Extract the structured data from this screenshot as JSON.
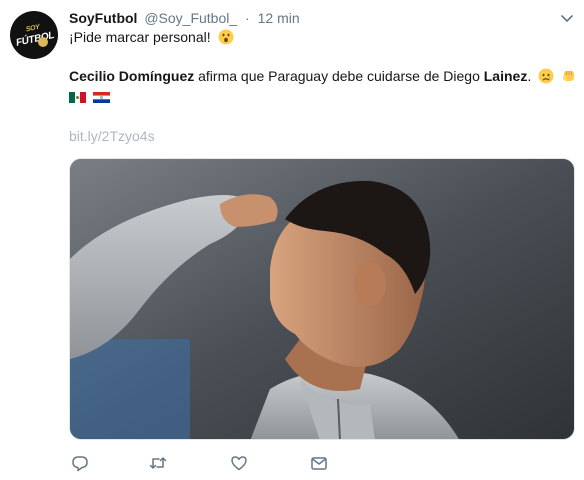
{
  "tweet": {
    "author_name": "SoyFutbol",
    "author_handle": "@Soy_Futbol_",
    "separator": "·",
    "time": "12 min",
    "avatar_text_top": "SOY",
    "avatar_text_main": "FÚTBOL",
    "line1": "¡Pide marcar personal!",
    "line2_bold_1": "Cecilio Domínguez",
    "line2_mid": " afirma que Paraguay debe cuidarse de Diego ",
    "line2_bold_2": "Lainez",
    "line2_end": ".",
    "link": "bit.ly/2Tzyo4s",
    "emojis": [
      "surprised-face",
      "worried-face",
      "raised-fist"
    ],
    "flags": [
      "mexico-flag",
      "paraguay-flag"
    ]
  },
  "actions": [
    "reply-icon",
    "retweet-icon",
    "like-icon",
    "message-icon"
  ],
  "colors": {
    "text": "#14171a",
    "muted": "#657786",
    "link": "#aab8c2",
    "border": "#e1e8ed"
  }
}
